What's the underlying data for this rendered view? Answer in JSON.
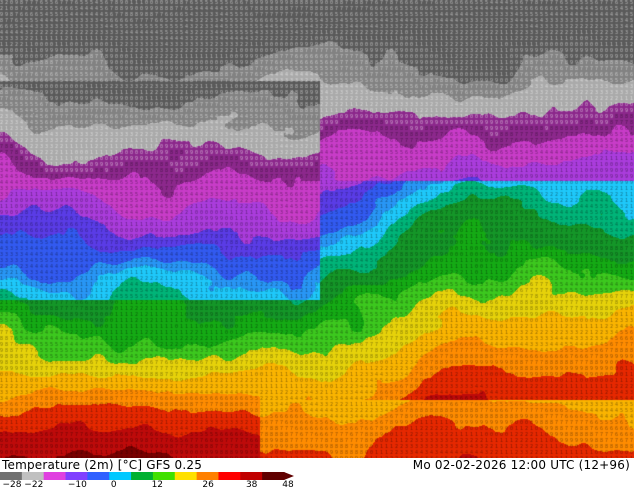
{
  "title": {
    "left": "Temperature (2m) [°C] GFS 0.25",
    "right": "Mo 02-02-2026 12:00 UTC (12+96)"
  },
  "legend": {
    "stops": [
      {
        "value": -28,
        "color": "#707070"
      },
      {
        "value": -22,
        "color": "#c0c0c0"
      },
      {
        "value": -16,
        "color": "#e040e0"
      },
      {
        "value": -10,
        "color": "#8040ff"
      },
      {
        "value": -4,
        "color": "#3060ff"
      },
      {
        "value": 0,
        "color": "#00c8ff"
      },
      {
        "value": 6,
        "color": "#00b030"
      },
      {
        "value": 12,
        "color": "#40e000"
      },
      {
        "value": 18,
        "color": "#ffe000"
      },
      {
        "value": 26,
        "color": "#ff8000"
      },
      {
        "value": 32,
        "color": "#ff0000"
      },
      {
        "value": 38,
        "color": "#c00000"
      },
      {
        "value": 48,
        "color": "#600000"
      }
    ],
    "tick_labels": [
      "-28",
      "-22",
      "-10",
      "0",
      "12",
      "26",
      "38",
      "48"
    ]
  }
}
